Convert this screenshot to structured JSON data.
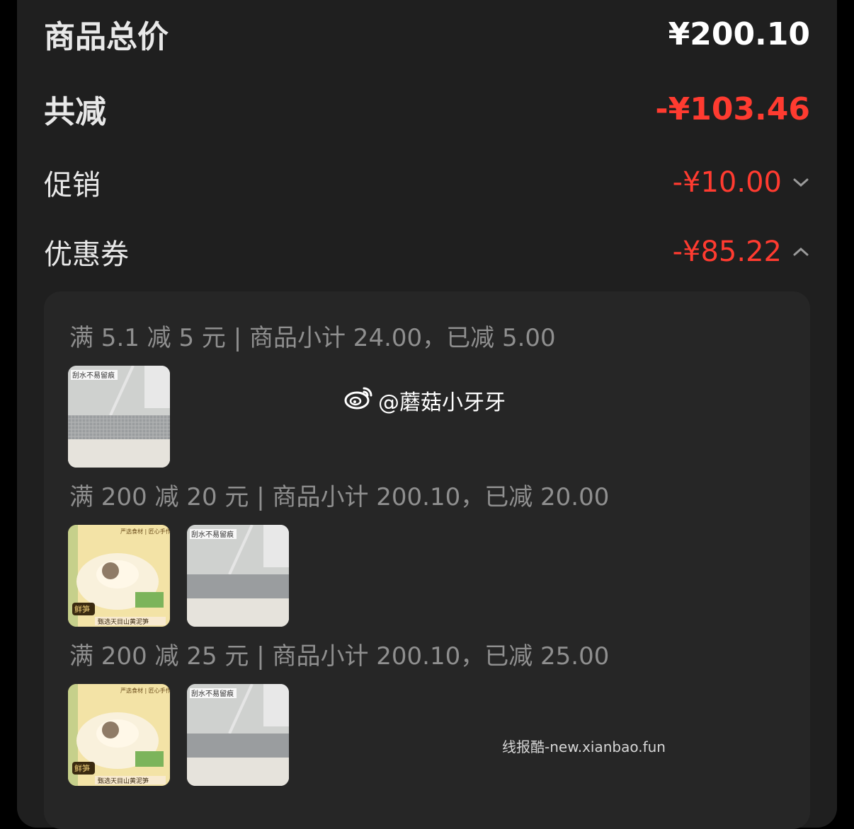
{
  "summary": {
    "total_label": "商品总价",
    "total_value": "¥200.10",
    "reduction_label": "共减",
    "reduction_value": "-¥103.46",
    "promo_label": "促销",
    "promo_value": "-¥10.00",
    "coupon_label": "优惠券",
    "coupon_value": "-¥85.22"
  },
  "coupons": [
    {
      "line": "满 5.1 减 5 元 | 商品小计 24.00，已减 5.00",
      "products": [
        "mop-thumbnail"
      ]
    },
    {
      "line": "满 200 减 20 元 | 商品小计 200.10，已减 20.00",
      "products": [
        "dumpling-thumbnail",
        "mop-thumbnail"
      ]
    },
    {
      "line": "满 200 减 25 元 | 商品小计 200.10，已减 25.00",
      "products": [
        "dumpling-thumbnail",
        "mop-thumbnail"
      ]
    }
  ],
  "product_image_text": {
    "mop_caption": "刮水不易留痕",
    "food_header": "严选食材 | 匠心手作",
    "food_badge": "鲜笋",
    "food_caption": "甄选天目山黄泥笋"
  },
  "watermarks": {
    "weibo": "@蘑菇小牙牙",
    "site": "线报酷-new.xianbao.fun"
  },
  "colors": {
    "panel_bg": "#1f1f1f",
    "detail_bg": "#262626",
    "accent_red": "#ff3b30",
    "muted_text": "#8f8f8f"
  },
  "icons": {
    "promo_toggle": "chevron-down-icon",
    "coupon_toggle": "chevron-up-icon",
    "weibo_logo": "weibo-icon"
  }
}
